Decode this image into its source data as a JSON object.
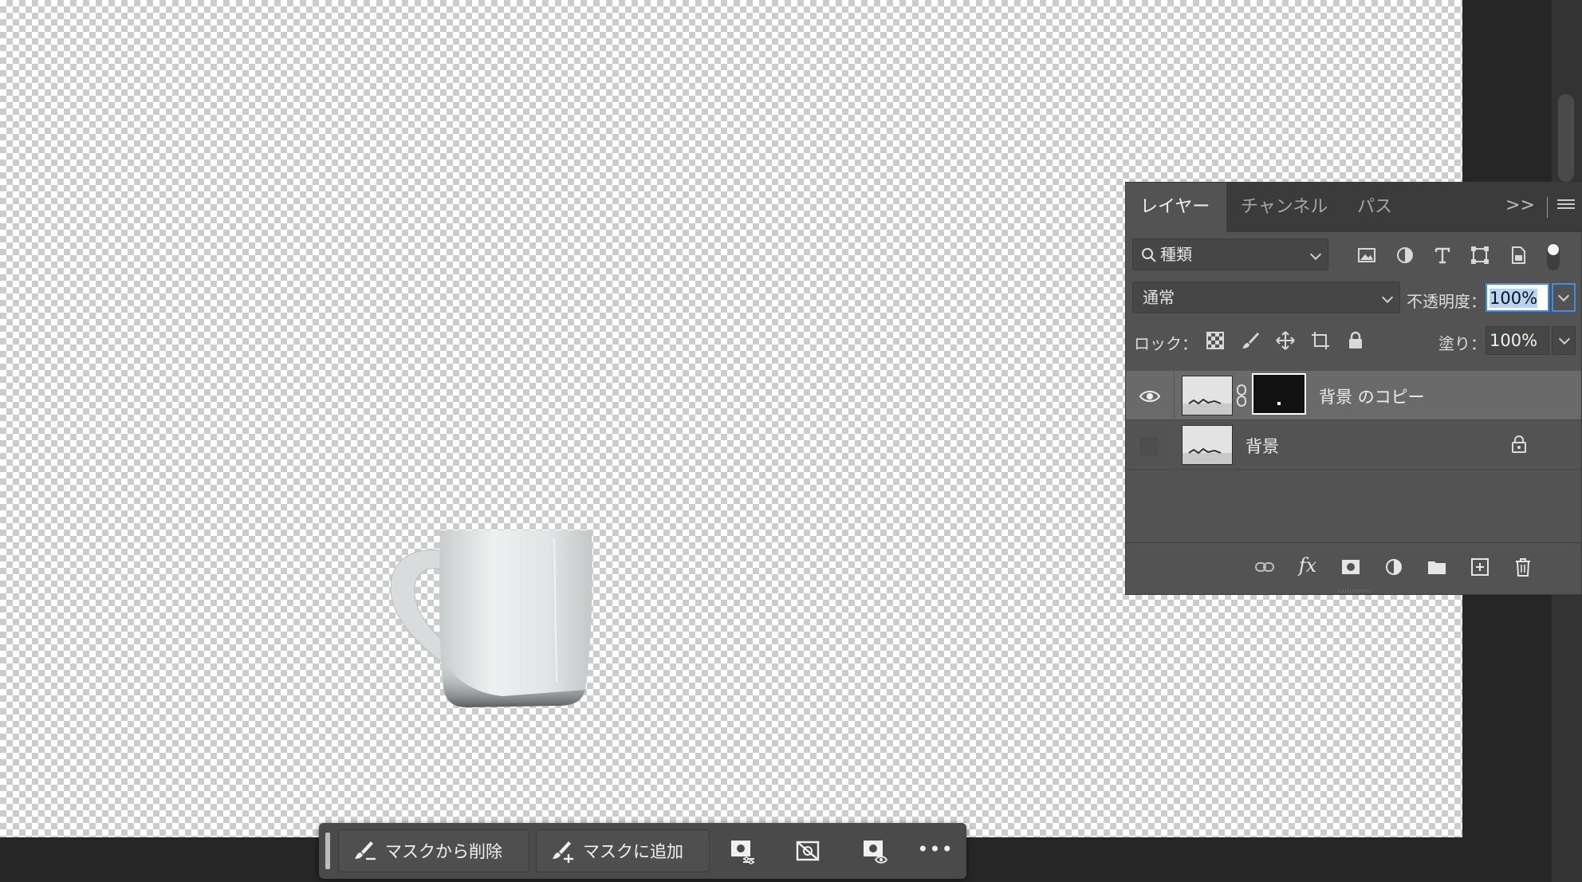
{
  "layers_panel": {
    "tabs": [
      {
        "label": "レイヤー",
        "active": true
      },
      {
        "label": "チャンネル",
        "active": false
      },
      {
        "label": "パス",
        "active": false
      }
    ],
    "collapse_label": ">>",
    "filter": {
      "value": "種類",
      "icon": "search-icon"
    },
    "filter_icons": [
      "image-filter-icon",
      "adjustment-filter-icon",
      "type-filter-icon",
      "shape-filter-icon",
      "smart-object-filter-icon"
    ],
    "blend_mode": "通常",
    "opacity_label": "不透明度：",
    "opacity_value": "100%",
    "lock_label": "ロック：",
    "lock_icons": [
      "lock-transparent-icon",
      "lock-paint-icon",
      "lock-position-icon",
      "lock-artboard-icon",
      "lock-all-icon"
    ],
    "fill_label": "塗り：",
    "fill_value": "100%",
    "layers": [
      {
        "name": "背景 のコピー",
        "visible": true,
        "selected": true,
        "has_mask": true
      },
      {
        "name": "背景",
        "visible": false,
        "selected": false,
        "locked": true
      }
    ],
    "bottom_icons": [
      "link-layers-icon",
      "fx-icon",
      "add-mask-icon",
      "adjustment-layer-icon",
      "new-group-icon",
      "new-layer-icon",
      "trash-icon"
    ],
    "fx_label": "fx"
  },
  "taskbar": {
    "subtract_label": "マスクから削除",
    "add_label": "マスクに追加",
    "more_label": "•••"
  },
  "colors": {
    "canvas_check_dark": "#cccccc",
    "panel_bg": "#535353",
    "selected_row": "#6a6a6a",
    "focus_blue": "#3d8ee6"
  }
}
